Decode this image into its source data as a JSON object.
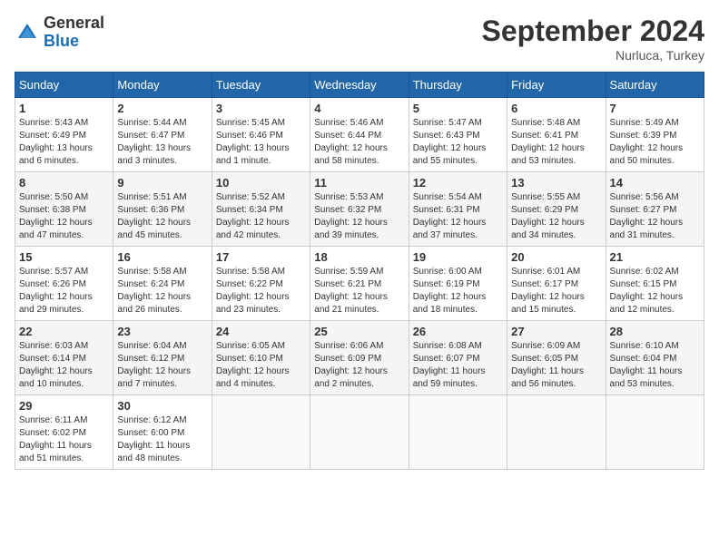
{
  "header": {
    "logo_general": "General",
    "logo_blue": "Blue",
    "month_title": "September 2024",
    "location": "Nurluca, Turkey"
  },
  "columns": [
    "Sunday",
    "Monday",
    "Tuesday",
    "Wednesday",
    "Thursday",
    "Friday",
    "Saturday"
  ],
  "weeks": [
    [
      {
        "day": "1",
        "info": "Sunrise: 5:43 AM\nSunset: 6:49 PM\nDaylight: 13 hours\nand 6 minutes."
      },
      {
        "day": "2",
        "info": "Sunrise: 5:44 AM\nSunset: 6:47 PM\nDaylight: 13 hours\nand 3 minutes."
      },
      {
        "day": "3",
        "info": "Sunrise: 5:45 AM\nSunset: 6:46 PM\nDaylight: 13 hours\nand 1 minute."
      },
      {
        "day": "4",
        "info": "Sunrise: 5:46 AM\nSunset: 6:44 PM\nDaylight: 12 hours\nand 58 minutes."
      },
      {
        "day": "5",
        "info": "Sunrise: 5:47 AM\nSunset: 6:43 PM\nDaylight: 12 hours\nand 55 minutes."
      },
      {
        "day": "6",
        "info": "Sunrise: 5:48 AM\nSunset: 6:41 PM\nDaylight: 12 hours\nand 53 minutes."
      },
      {
        "day": "7",
        "info": "Sunrise: 5:49 AM\nSunset: 6:39 PM\nDaylight: 12 hours\nand 50 minutes."
      }
    ],
    [
      {
        "day": "8",
        "info": "Sunrise: 5:50 AM\nSunset: 6:38 PM\nDaylight: 12 hours\nand 47 minutes."
      },
      {
        "day": "9",
        "info": "Sunrise: 5:51 AM\nSunset: 6:36 PM\nDaylight: 12 hours\nand 45 minutes."
      },
      {
        "day": "10",
        "info": "Sunrise: 5:52 AM\nSunset: 6:34 PM\nDaylight: 12 hours\nand 42 minutes."
      },
      {
        "day": "11",
        "info": "Sunrise: 5:53 AM\nSunset: 6:32 PM\nDaylight: 12 hours\nand 39 minutes."
      },
      {
        "day": "12",
        "info": "Sunrise: 5:54 AM\nSunset: 6:31 PM\nDaylight: 12 hours\nand 37 minutes."
      },
      {
        "day": "13",
        "info": "Sunrise: 5:55 AM\nSunset: 6:29 PM\nDaylight: 12 hours\nand 34 minutes."
      },
      {
        "day": "14",
        "info": "Sunrise: 5:56 AM\nSunset: 6:27 PM\nDaylight: 12 hours\nand 31 minutes."
      }
    ],
    [
      {
        "day": "15",
        "info": "Sunrise: 5:57 AM\nSunset: 6:26 PM\nDaylight: 12 hours\nand 29 minutes."
      },
      {
        "day": "16",
        "info": "Sunrise: 5:58 AM\nSunset: 6:24 PM\nDaylight: 12 hours\nand 26 minutes."
      },
      {
        "day": "17",
        "info": "Sunrise: 5:58 AM\nSunset: 6:22 PM\nDaylight: 12 hours\nand 23 minutes."
      },
      {
        "day": "18",
        "info": "Sunrise: 5:59 AM\nSunset: 6:21 PM\nDaylight: 12 hours\nand 21 minutes."
      },
      {
        "day": "19",
        "info": "Sunrise: 6:00 AM\nSunset: 6:19 PM\nDaylight: 12 hours\nand 18 minutes."
      },
      {
        "day": "20",
        "info": "Sunrise: 6:01 AM\nSunset: 6:17 PM\nDaylight: 12 hours\nand 15 minutes."
      },
      {
        "day": "21",
        "info": "Sunrise: 6:02 AM\nSunset: 6:15 PM\nDaylight: 12 hours\nand 12 minutes."
      }
    ],
    [
      {
        "day": "22",
        "info": "Sunrise: 6:03 AM\nSunset: 6:14 PM\nDaylight: 12 hours\nand 10 minutes."
      },
      {
        "day": "23",
        "info": "Sunrise: 6:04 AM\nSunset: 6:12 PM\nDaylight: 12 hours\nand 7 minutes."
      },
      {
        "day": "24",
        "info": "Sunrise: 6:05 AM\nSunset: 6:10 PM\nDaylight: 12 hours\nand 4 minutes."
      },
      {
        "day": "25",
        "info": "Sunrise: 6:06 AM\nSunset: 6:09 PM\nDaylight: 12 hours\nand 2 minutes."
      },
      {
        "day": "26",
        "info": "Sunrise: 6:08 AM\nSunset: 6:07 PM\nDaylight: 11 hours\nand 59 minutes."
      },
      {
        "day": "27",
        "info": "Sunrise: 6:09 AM\nSunset: 6:05 PM\nDaylight: 11 hours\nand 56 minutes."
      },
      {
        "day": "28",
        "info": "Sunrise: 6:10 AM\nSunset: 6:04 PM\nDaylight: 11 hours\nand 53 minutes."
      }
    ],
    [
      {
        "day": "29",
        "info": "Sunrise: 6:11 AM\nSunset: 6:02 PM\nDaylight: 11 hours\nand 51 minutes."
      },
      {
        "day": "30",
        "info": "Sunrise: 6:12 AM\nSunset: 6:00 PM\nDaylight: 11 hours\nand 48 minutes."
      },
      null,
      null,
      null,
      null,
      null
    ]
  ]
}
